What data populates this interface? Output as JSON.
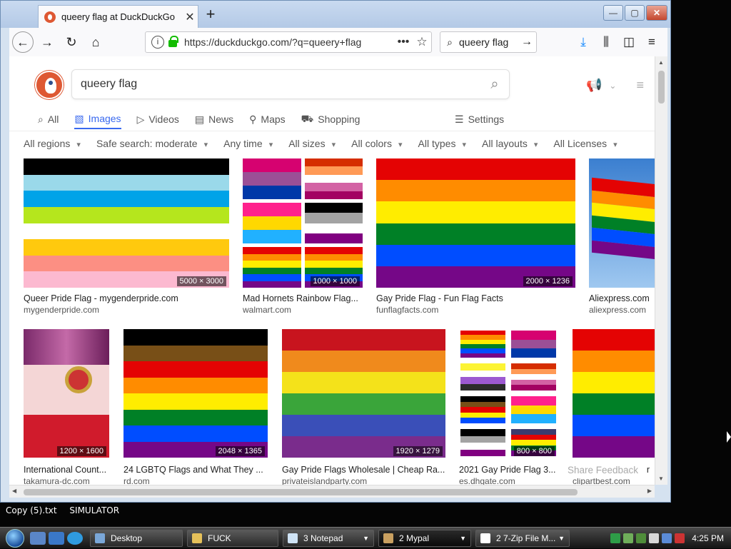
{
  "browser": {
    "tab_title": "queery flag at DuckDuckGo",
    "url": "https://duckduckgo.com/?q=queery+flag",
    "search_query": "queery flag",
    "window_buttons": {
      "minimize": "—",
      "maximize": "▢",
      "close": "✕"
    }
  },
  "page": {
    "search_value": "queery flag",
    "vertical_tabs": [
      {
        "label": "All",
        "icon": "search-icon"
      },
      {
        "label": "Images",
        "icon": "image-icon",
        "active": true
      },
      {
        "label": "Videos",
        "icon": "play-icon"
      },
      {
        "label": "News",
        "icon": "news-icon"
      },
      {
        "label": "Maps",
        "icon": "map-pin-icon"
      },
      {
        "label": "Shopping",
        "icon": "shopping-bag-icon"
      }
    ],
    "settings_label": "Settings",
    "filters": [
      "All regions",
      "Safe search: moderate",
      "Any time",
      "All sizes",
      "All colors",
      "All types",
      "All layouts",
      "All Licenses"
    ],
    "results": [
      {
        "title": "Queer Pride Flag - mygenderpride.com",
        "domain": "mygenderpride.com",
        "dims": "5000 × 3000"
      },
      {
        "title": "Mad Hornets Rainbow Flag...",
        "domain": "walmart.com",
        "dims": "1000 × 1000"
      },
      {
        "title": "Gay Pride Flag - Fun Flag Facts",
        "domain": "funflagfacts.com",
        "dims": "2000 × 1236"
      },
      {
        "title": "Aliexpress.com",
        "domain": "aliexpress.com",
        "dims": ""
      },
      {
        "title": "International Count...",
        "domain": "takamura-dc.com",
        "dims": "1200 × 1600"
      },
      {
        "title": "24 LGBTQ Flags and What They ...",
        "domain": "rd.com",
        "dims": "2048 × 1365"
      },
      {
        "title": "Gay Pride Flags Wholesale | Cheap Ra...",
        "domain": "privateislandparty.com",
        "dims": "1920 × 1279"
      },
      {
        "title": "2021 Gay Pride Flag 3...",
        "domain": "es.dhgate.com",
        "dims": "800 × 800"
      },
      {
        "title": "r",
        "domain": "clipartbest.com",
        "dims": ""
      }
    ],
    "share_feedback": "Share Feedback"
  },
  "desktop": {
    "icons": [
      "Copy (5).txt",
      "SIMULATOR"
    ]
  },
  "taskbar": {
    "items": [
      {
        "label": "Desktop"
      },
      {
        "label": "FUCK"
      },
      {
        "label": "3 Notepad"
      },
      {
        "label": "2 Mypal"
      },
      {
        "label": "2 7-Zip File M..."
      }
    ],
    "clock": "4:25 PM"
  },
  "colors": {
    "accent": "#3969ef",
    "ddg_orange": "#de5833",
    "lock_green": "#12bc00"
  }
}
